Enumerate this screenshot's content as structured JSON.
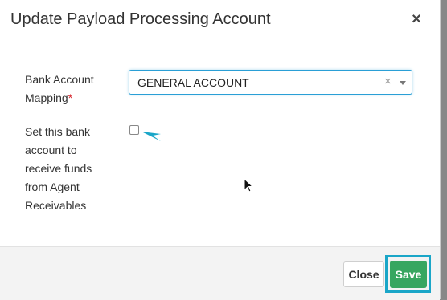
{
  "dialog": {
    "title": "Update Payload Processing Account",
    "close_symbol": "×"
  },
  "form": {
    "bank_mapping_label": "Bank Account Mapping",
    "required_marker": "*",
    "bank_mapping_value": "GENERAL ACCOUNT",
    "clear_symbol": "×",
    "agent_receivables_label": "Set this bank account to receive funds from Agent Receivables",
    "agent_receivables_checked": false
  },
  "footer": {
    "close_label": "Close",
    "save_label": "Save"
  },
  "colors": {
    "save_button": "#37a660",
    "highlight": "#1aa6c8",
    "focus_border": "#2a9fd6"
  }
}
